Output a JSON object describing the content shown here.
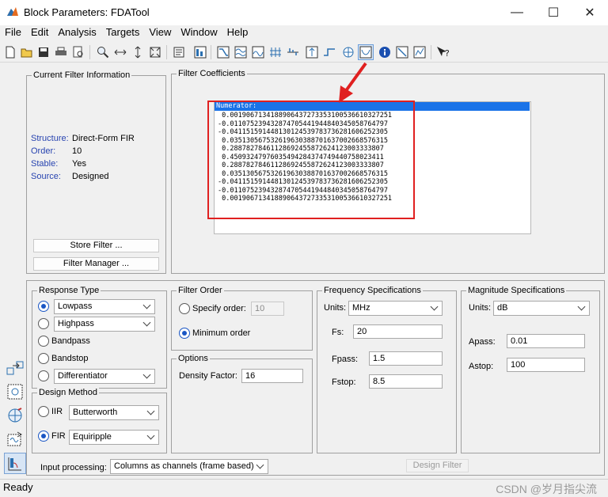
{
  "window": {
    "title": "Block Parameters: FDATool",
    "minimize": "—",
    "maximize": "☐",
    "close": "✕"
  },
  "menu": [
    "File",
    "Edit",
    "Analysis",
    "Targets",
    "View",
    "Window",
    "Help"
  ],
  "current_filter": {
    "title": "Current Filter Information",
    "structure_label": "Structure:",
    "structure_value": "Direct-Form FIR",
    "order_label": "Order:",
    "order_value": "10",
    "stable_label": "Stable:",
    "stable_value": "Yes",
    "source_label": "Source:",
    "source_value": "Designed",
    "store_filter_button": "Store Filter ...",
    "filter_manager_button": "Filter Manager ..."
  },
  "coefficients": {
    "title": "Filter Coefficients",
    "header": "Numerator:",
    "lines": [
      " 0.0019067134188906437273353100536610327251",
      "-0.011075239432874705441944840345058764797",
      "-0.041151591448130124539783736281606252305",
      " 0.035130567532619630388701637002668576315",
      " 0.28878278461128692455872624123003333807",
      " 0.45093247976035494284374749440758023411",
      " 0.28878278461128692455872624123003333807",
      " 0.035130567532619630388701637002668576315",
      "-0.041151591448130124539783736281606252305",
      "-0.011075239432874705441944840345058764797",
      " 0.0019067134188906437273353100536610327251"
    ]
  },
  "response_type": {
    "title": "Response Type",
    "lowpass": "Lowpass",
    "highpass": "Highpass",
    "bandpass": "Bandpass",
    "bandstop": "Bandstop",
    "differentiator": "Differentiator",
    "selected": "Lowpass"
  },
  "design_method": {
    "title": "Design Method",
    "iir_label": "IIR",
    "iir_value": "Butterworth",
    "fir_label": "FIR",
    "fir_value": "Equiripple",
    "selected": "FIR"
  },
  "filter_order": {
    "title": "Filter Order",
    "specify_label": "Specify order:",
    "specify_value": "10",
    "minimum_label": "Minimum order",
    "selected": "Minimum order"
  },
  "options": {
    "title": "Options",
    "density_label": "Density Factor:",
    "density_value": "16"
  },
  "frequency": {
    "title": "Frequency Specifications",
    "units_label": "Units:",
    "units_value": "MHz",
    "fs_label": "Fs:",
    "fs_value": "20",
    "fpass_label": "Fpass:",
    "fpass_value": "1.5",
    "fstop_label": "Fstop:",
    "fstop_value": "8.5"
  },
  "magnitude": {
    "title": "Magnitude Specifications",
    "units_label": "Units:",
    "units_value": "dB",
    "apass_label": "Apass:",
    "apass_value": "0.01",
    "astop_label": "Astop:",
    "astop_value": "100"
  },
  "bottom": {
    "input_processing_label": "Input processing:",
    "input_processing_value": "Columns as channels (frame based)",
    "design_filter_button": "Design Filter"
  },
  "status": {
    "text": "Ready",
    "watermark": "CSDN @岁月指尖流"
  },
  "colors": {
    "accent": "#1a73e8",
    "highlight_box": "#e02020",
    "label_blue": "#2844b0"
  },
  "toolbar_icons": [
    "new-icon",
    "open-icon",
    "save-icon",
    "print-icon",
    "print-preview-icon",
    "zoom-in-icon",
    "zoom-x-icon",
    "zoom-y-icon",
    "full-view-icon",
    "filter-spec-icon",
    "magnitude-response-icon",
    "phase-response-icon",
    "magnitude-phase-icon",
    "group-delay-icon",
    "phase-delay-icon",
    "impulse-response-icon",
    "step-response-icon",
    "pole-zero-icon",
    "filter-coefficients-icon",
    "filter-info-icon",
    "magnitude-estimate-icon",
    "noise-psd-icon",
    "whats-this-icon"
  ]
}
